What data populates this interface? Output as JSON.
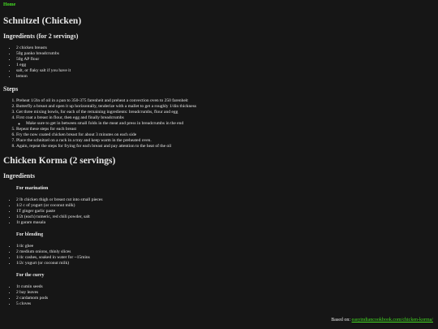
{
  "nav": {
    "home_label": "Home"
  },
  "schnitzel": {
    "title": "Schnitzel (Chicken)",
    "ingredients_heading": "Ingredients (for 2 servings)",
    "ingredients": [
      "2 chicken breasts",
      "50g panko breadcrumbs",
      "50g AP flour",
      "1 egg",
      "salt, or flaky salt if you have it",
      "lemon"
    ],
    "steps_heading": "Steps",
    "steps": [
      "Preheat 1/2in of oil in a pan to 350-375 farenheit and preheat a convection oven to 250 farenheit",
      "Butterfly a breast and open it up horizontally, tenderize with a mallet to get a roughly 1/4in thickness",
      "Get three mixing bowls, for each of the remaining ingredients: breadcrumbs, flour and egg",
      "First coat a breast in flour, then egg and finally breadcrumbs",
      "Repeat these steps for each breast",
      "Fry the now coated chicken breast for about 3 minutes on each side",
      "Place the schnitzel on a rack in a tray and keep warm in the preheated oven.",
      "Again, repeat the steps for frying for each breast and pay attention to the heat of the oil"
    ],
    "step4_substep": "Make sure to get in between small folds in the meat and press in breadcrumbs in the end"
  },
  "korma": {
    "title": "Chicken Korma (2 servings)",
    "ingredients_heading": "Ingredients",
    "marination_heading": "For marination",
    "marination": [
      "2 lb chicken thigh or breast cut into small pieces",
      "1/2 c of yogurt (or coconut milk)",
      "1T ginger garlic paste",
      "1/2t (each) tumeric, red chili powder, salt",
      "1t garam masala"
    ],
    "blending_heading": "For blending",
    "blending": [
      "1/4c ghee",
      "2 medium onions, thinly slices",
      "1/4c cashes, soaked in water for ~15mins",
      "1/2c yogurt (or coconut milk)"
    ],
    "curry_heading": "For the curry",
    "curry": [
      "1t cumin seeds",
      "2 bay leaves",
      "2 cardamom pods",
      "5 cloves"
    ]
  },
  "footer": {
    "based_on_label": "Based on:",
    "based_on_link": "easyindiancookbook.com/chicken-korma/"
  }
}
